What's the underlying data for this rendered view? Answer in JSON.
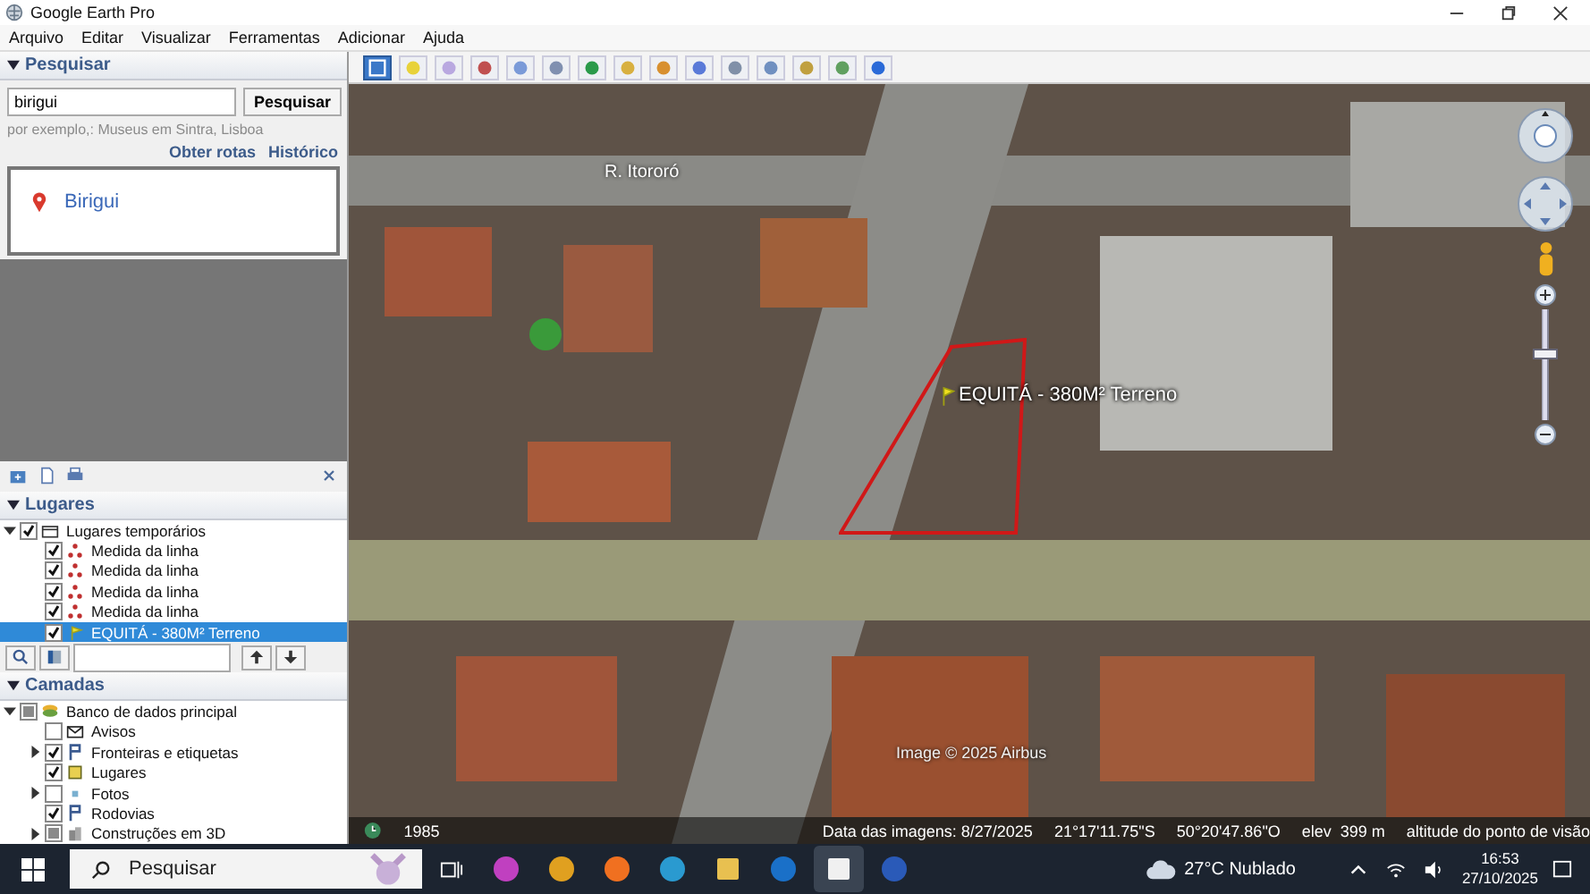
{
  "window": {
    "title": "Google Earth Pro"
  },
  "menu": [
    "Arquivo",
    "Editar",
    "Visualizar",
    "Ferramentas",
    "Adicionar",
    "Ajuda"
  ],
  "search": {
    "header": "Pesquisar",
    "expanded": true,
    "value": "birigui",
    "button": "Pesquisar",
    "hint": "por exemplo,: Museus em Sintra, Lisboa",
    "links": [
      "Obter rotas",
      "Histórico"
    ],
    "results": [
      "Birigui"
    ]
  },
  "places": {
    "header": "Lugares",
    "expanded": true,
    "items": [
      {
        "label": "Lugares temporários",
        "kind": "folder",
        "checked": true,
        "expanded": true,
        "selected": false,
        "children": [
          {
            "label": "Medida da linha",
            "kind": "measure",
            "checked": true,
            "selected": false
          },
          {
            "label": "Medida da linha",
            "kind": "measure",
            "checked": true,
            "selected": false
          },
          {
            "label": "Medida da linha",
            "kind": "measure",
            "checked": true,
            "selected": false
          },
          {
            "label": "Medida da linha",
            "kind": "measure",
            "checked": true,
            "selected": false
          },
          {
            "label": "EQUITÁ - 380M² Terreno",
            "kind": "placemark",
            "checked": true,
            "selected": true
          }
        ]
      }
    ]
  },
  "layers": {
    "header": "Camadas",
    "expanded": true,
    "items": [
      {
        "label": "Banco de dados principal",
        "kind": "database",
        "checked": true,
        "partial": true,
        "expanded": true,
        "selected": false,
        "children": [
          {
            "label": "Avisos",
            "kind": "envelope",
            "checked": false,
            "selected": false
          },
          {
            "label": "Fronteiras e etiquetas",
            "kind": "border",
            "checked": true,
            "expanded": false,
            "selected": false
          },
          {
            "label": "Lugares",
            "kind": "places",
            "checked": true,
            "selected": false
          },
          {
            "label": "Fotos",
            "kind": "photo",
            "checked": false,
            "expanded": false,
            "selected": false
          },
          {
            "label": "Rodovias",
            "kind": "road",
            "checked": true,
            "selected": false
          },
          {
            "label": "Construções em 3D",
            "kind": "building",
            "checked": true,
            "partial": true,
            "expanded": false,
            "selected": false
          }
        ]
      }
    ]
  },
  "toolbar": [
    {
      "selected": true
    },
    {
      "selected": false
    },
    {
      "selected": false
    },
    {
      "selected": false
    },
    {
      "selected": false
    },
    {
      "selected": false
    },
    {
      "selected": false
    },
    {
      "selected": false
    },
    {
      "selected": false
    },
    {
      "selected": false
    },
    {
      "selected": false
    },
    {
      "selected": false
    },
    {
      "selected": false
    },
    {
      "selected": false
    },
    {
      "selected": false
    }
  ],
  "map": {
    "street_label": "R. Itororó",
    "placemark_label": "EQUITÁ - 380M² Terreno",
    "credit": "Image © 2025 Airbus",
    "zoom": {
      "level": 0.61
    },
    "status": {
      "year": "1985",
      "date": "Data das imagens: 8/27/2025",
      "lat": "21°17'11.75\"S",
      "lon": "50°20'47.86\"O",
      "elev": "elev  399 m",
      "eye": "altitude do ponto de visão"
    }
  },
  "taskbar": {
    "search_placeholder": "Pesquisar",
    "apps": [
      {
        "selected": false
      },
      {
        "selected": false
      },
      {
        "selected": false
      },
      {
        "selected": false
      },
      {
        "selected": false
      },
      {
        "selected": false
      },
      {
        "selected": true
      },
      {
        "selected": false
      }
    ],
    "weather": "27°C Nublado",
    "time": "16:53",
    "date": "27/10/2025"
  }
}
